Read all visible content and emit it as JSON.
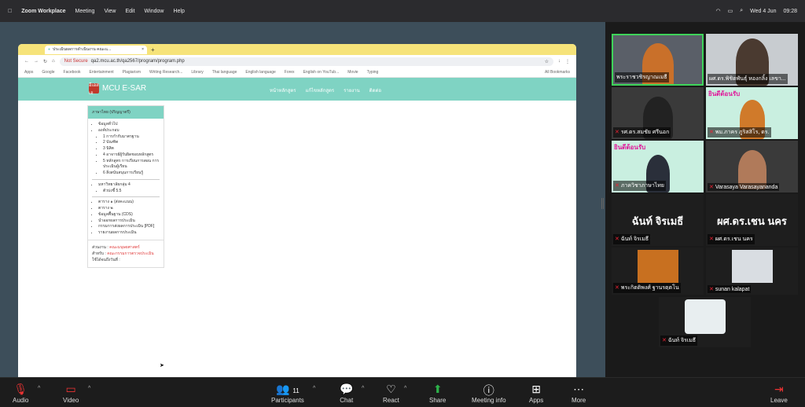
{
  "menubar": {
    "app": "Zoom Workplace",
    "items": [
      "Meeting",
      "View",
      "Edit",
      "Window",
      "Help"
    ],
    "date": "Wed 4 Jun",
    "time": "09:28"
  },
  "browser": {
    "tab_title": "ประเมินผลการดำเนินงาน คณะแ...",
    "not_secure": "Not Secure",
    "url": "qa2.mcu.ac.th/qa2567/program/program.php",
    "bookmarks": [
      "Apps",
      "Google",
      "Facebook",
      "Entertainment",
      "Plagiarism",
      "Writing Research...",
      "Library",
      "Thai language",
      "English language",
      "Forex",
      "English on YouTub...",
      "Movie",
      "Typing"
    ],
    "all_bookmarks": "All Bookmarks"
  },
  "site": {
    "logo_text": "MCU E-SAR",
    "logo_badge": "อีเอสเอ",
    "nav": [
      "หน้าหลักสูตร",
      "แก้ไขหลักสูตร",
      "รายงาน",
      "ติดต่อ"
    ],
    "sidebar_title": "ภาษาไทย (ปริญญาตรี)",
    "general": "ข้อมูลทั่วไป",
    "components": "องค์ประกอบ",
    "comp_items": [
      "1 การกำกับมาตรฐาน",
      "2 บัณฑิต",
      "3 นิสิต",
      "4 อาจารย์ผู้รับผิดชอบหลักสูตร",
      "5 หลักสูตร การเรียนการสอน การประเมินผู้เรียน",
      "6 สิ่งสนับสนุนการเรียนรู้"
    ],
    "univ_group": "มหาวิทยาลัยกลุ่ม 4",
    "indicator": "ตัวบ่งชี้ 5.5",
    "tables": [
      "ตาราง ๑ (ส่งคะแนน)",
      "ตาราง ๒",
      "ข้อมูลพื้นฐาน (CDS)",
      "นำออกผลการประเมิน",
      "กรรมการส่งผลการประเมิน [PDF]",
      "รายงานผลการประเมิน"
    ],
    "footer_part": "ส่วนงาน :",
    "footer_part_val": "คณะมนุษยศาสตร์",
    "footer_for": "สำหรับ :",
    "footer_for_val": "คณะกรรมการตรวจประเมิน",
    "footer_date": "ใช้ได้จนถึงวันที่ :"
  },
  "gallery": {
    "tiles": [
      {
        "name": "พระราชวชิรญาณเมธี",
        "muted": false
      },
      {
        "name": "ผศ.ดร.พิชิตพันธุ์ หองกลิ้ง เลขา...",
        "muted": false
      },
      {
        "name": "รศ.ดร.สมชัย ศรีนอก",
        "muted": true
      },
      {
        "name": "พม.ภาคร ภูริสสิโร, ดร.",
        "muted": true
      },
      {
        "name": "ภาควิชาภาษาไทย",
        "muted": true
      },
      {
        "name": "Varasaya Varasayananda",
        "muted": true
      },
      {
        "name": "ฉันท์ จิรเมธี",
        "big": "ฉันท์ จิรเมธี",
        "muted": true
      },
      {
        "name": "ผศ.ดร.เชน นคร",
        "big": "ผศ.ดร.เชน นคร",
        "muted": true
      },
      {
        "name": "พระกิตติพงศ์ ฐานรตฺตโน",
        "muted": true
      },
      {
        "name": "sunan kalapat",
        "muted": true
      },
      {
        "name": "ฉันท์ จิรเมธี",
        "muted": true
      }
    ],
    "slide_text": "ยินดีต้อนรับ"
  },
  "toolbar": {
    "audio": "Audio",
    "video": "Video",
    "participants": "Participants",
    "participant_count": "11",
    "chat": "Chat",
    "react": "React",
    "share": "Share",
    "meeting_info": "Meeting info",
    "apps": "Apps",
    "more": "More",
    "leave": "Leave"
  },
  "colors": {
    "accent": "#7fd3c3",
    "red": "#e03a3a",
    "share_green": "#2db24a"
  }
}
